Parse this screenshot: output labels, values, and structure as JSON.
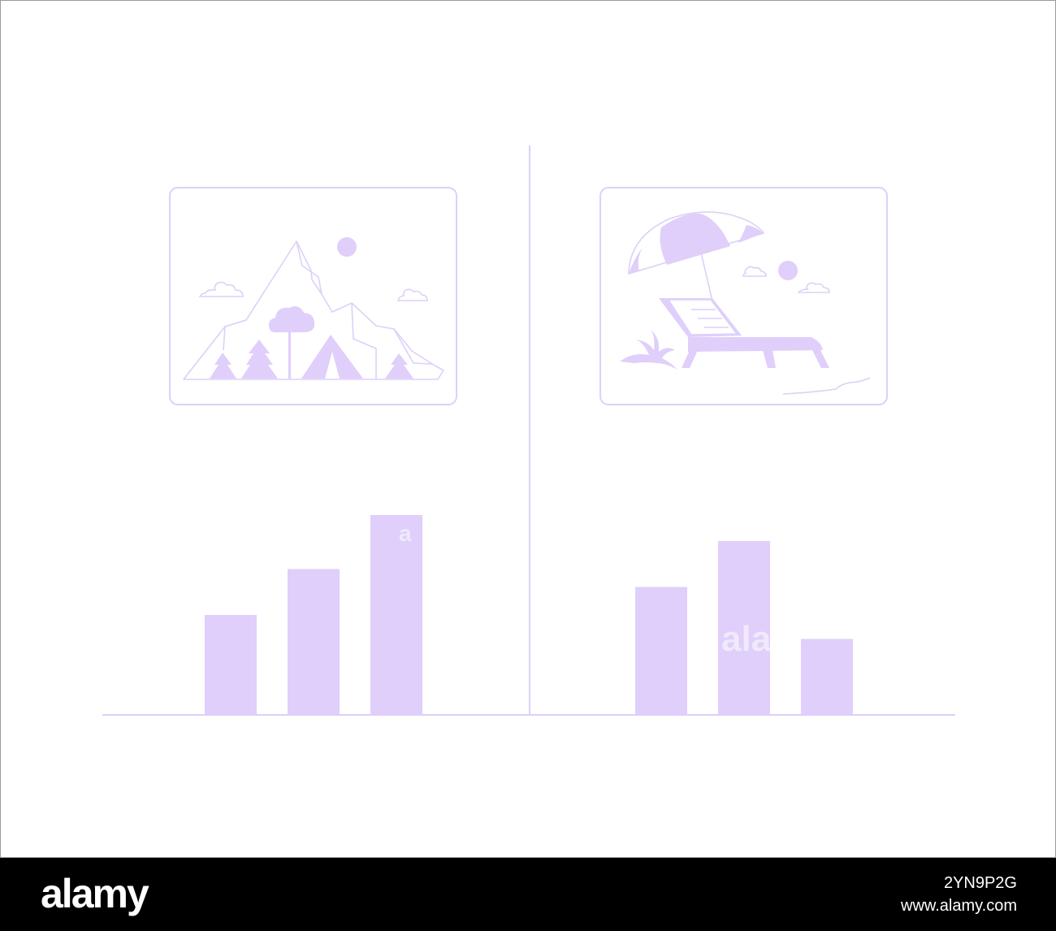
{
  "colors": {
    "accent": "#dfcffa",
    "line": "#ddd0f7",
    "background": "#ffffff",
    "footer": "#000000"
  },
  "icons": {
    "left": "mountain-camping-icon",
    "right": "beach-lounger-icon"
  },
  "chart_data": [
    {
      "type": "bar",
      "categories": [
        "",
        "",
        ""
      ],
      "values": [
        50,
        73,
        100
      ],
      "title": "",
      "xlabel": "",
      "ylabel": "",
      "ylim": [
        0,
        100
      ]
    },
    {
      "type": "bar",
      "categories": [
        "",
        "",
        ""
      ],
      "values": [
        64,
        87,
        38
      ],
      "title": "",
      "xlabel": "",
      "ylabel": "",
      "ylim": [
        0,
        100
      ]
    }
  ],
  "watermark": {
    "fragment_a": "a",
    "fragment_b": "ala"
  },
  "footer": {
    "logo": "alamy",
    "image_id": "2YN9P2G",
    "site": "www.alamy.com"
  }
}
